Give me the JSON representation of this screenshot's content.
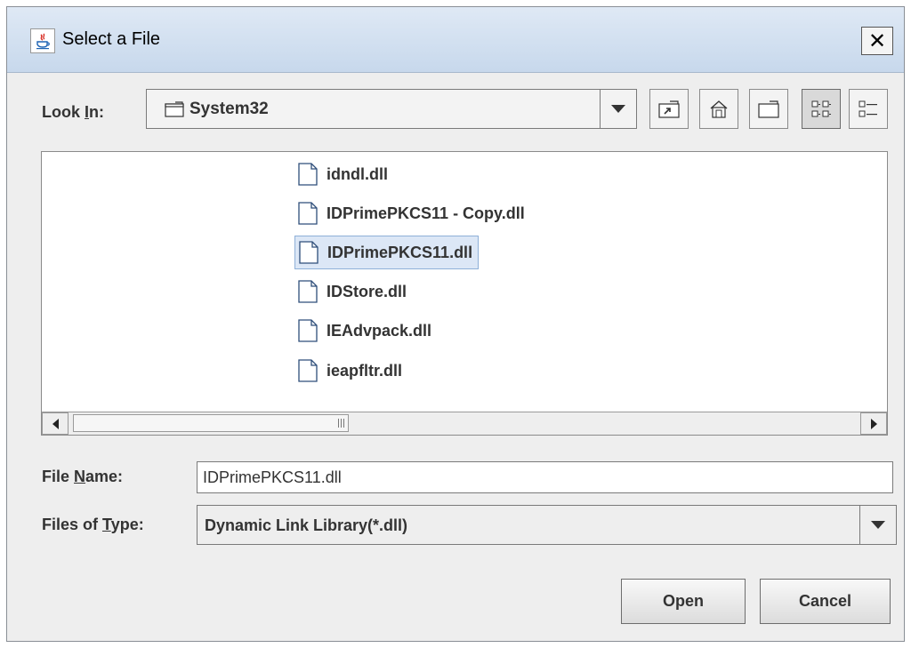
{
  "window": {
    "title": "Select a File",
    "close_glyph": "✕"
  },
  "look_in": {
    "label_before": "Look ",
    "label_mnemonic": "I",
    "label_after": "n:",
    "value": "System32",
    "folder_icon": "folder-icon"
  },
  "toolbar": {
    "buttons": [
      "up-one-level-icon",
      "home-icon",
      "new-folder-icon",
      "list-view-icon",
      "details-view-icon"
    ],
    "active_view": "list-view"
  },
  "files": [
    {
      "name": "idndl.dll",
      "selected": false
    },
    {
      "name": "IDPrimePKCS11 - Copy.dll",
      "selected": false
    },
    {
      "name": "IDPrimePKCS11.dll",
      "selected": true
    },
    {
      "name": "IDStore.dll",
      "selected": false
    },
    {
      "name": "IEAdvpack.dll",
      "selected": false
    },
    {
      "name": "ieapfltr.dll",
      "selected": false
    }
  ],
  "file_name": {
    "label_before": "File ",
    "label_mnemonic": "N",
    "label_after": "ame:",
    "value": "IDPrimePKCS11.dll"
  },
  "file_type": {
    "label_before": "Files of ",
    "label_mnemonic": "T",
    "label_after": "ype:",
    "value": "Dynamic Link Library(*.dll)"
  },
  "buttons": {
    "open": "Open",
    "cancel": "Cancel"
  },
  "colors": {
    "selection_bg": "#dce7f6",
    "selection_border": "#8fb0d8",
    "titlebar": "#c7d8ec"
  }
}
